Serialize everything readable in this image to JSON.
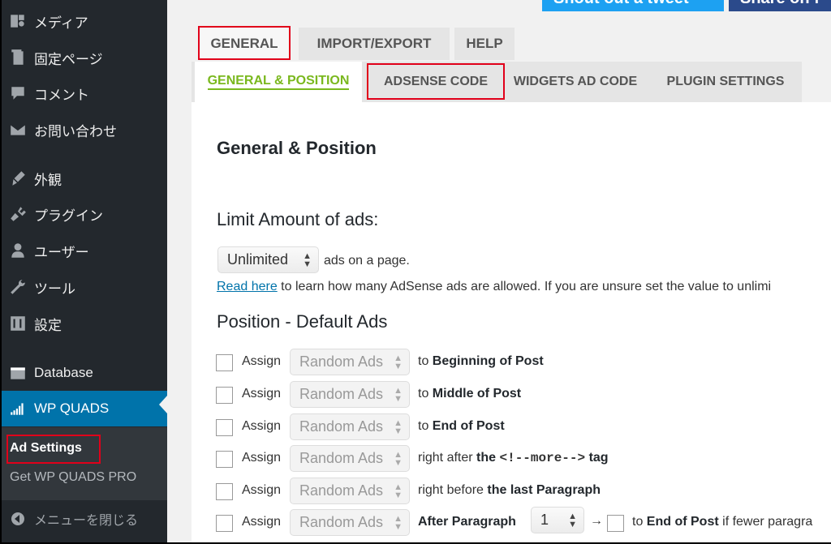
{
  "sidebar": {
    "items": [
      {
        "label": "メディア",
        "icon": "media-icon"
      },
      {
        "label": "固定ページ",
        "icon": "page-icon"
      },
      {
        "label": "コメント",
        "icon": "comment-icon"
      },
      {
        "label": "お問い合わせ",
        "icon": "mail-icon"
      },
      {
        "label": "外観",
        "icon": "appearance-icon"
      },
      {
        "label": "プラグイン",
        "icon": "plugin-icon"
      },
      {
        "label": "ユーザー",
        "icon": "user-icon"
      },
      {
        "label": "ツール",
        "icon": "wrench-icon"
      },
      {
        "label": "設定",
        "icon": "settings-icon"
      },
      {
        "label": "Database",
        "icon": "database-icon"
      },
      {
        "label": "WP QUADS",
        "icon": "wp-quads-icon"
      }
    ],
    "submenu": {
      "current": "Ad Settings",
      "pro": "Get WP QUADS PRO"
    },
    "collapse": "メニューを閉じる"
  },
  "top_buttons": {
    "tweet": "Shout out a tweet",
    "share": "Share on f"
  },
  "tabs": {
    "general": "GENERAL",
    "import_export": "IMPORT/EXPORT",
    "help": "HELP"
  },
  "subtabs": {
    "general_position": "GENERAL & POSITION",
    "adsense_code": "ADSENSE CODE",
    "widgets_ad_code": "WIDGETS AD CODE",
    "plugin_settings": "PLUGIN SETTINGS"
  },
  "content": {
    "heading": "General & Position",
    "limit_heading": "Limit Amount of ads:",
    "limit_value": "Unlimited",
    "limit_suffix": "ads on a page.",
    "read_here": "Read here",
    "read_here_rest": "to learn how many AdSense ads are allowed. If you are unsure set the value to unlimi",
    "position_heading": "Position - Default Ads",
    "assign_label": "Assign",
    "select_placeholder": "Random Ads",
    "rows": [
      {
        "pre": "to ",
        "bold": "Beginning of Post"
      },
      {
        "pre": "to ",
        "bold": "Middle of Post"
      },
      {
        "pre": "to ",
        "bold": "End of Post"
      },
      {
        "pre": "right after ",
        "bold": "the",
        "code": "<!--more-->",
        "post_bold": "tag"
      },
      {
        "pre": "right before ",
        "bold": "the last Paragraph"
      },
      {
        "pre": "",
        "bold": "After Paragraph"
      }
    ],
    "paragraph_number": "1",
    "arrow": "→",
    "fallback_text_pre": "to ",
    "fallback_bold": "End of Post",
    "fallback_rest": " if fewer paragra"
  }
}
